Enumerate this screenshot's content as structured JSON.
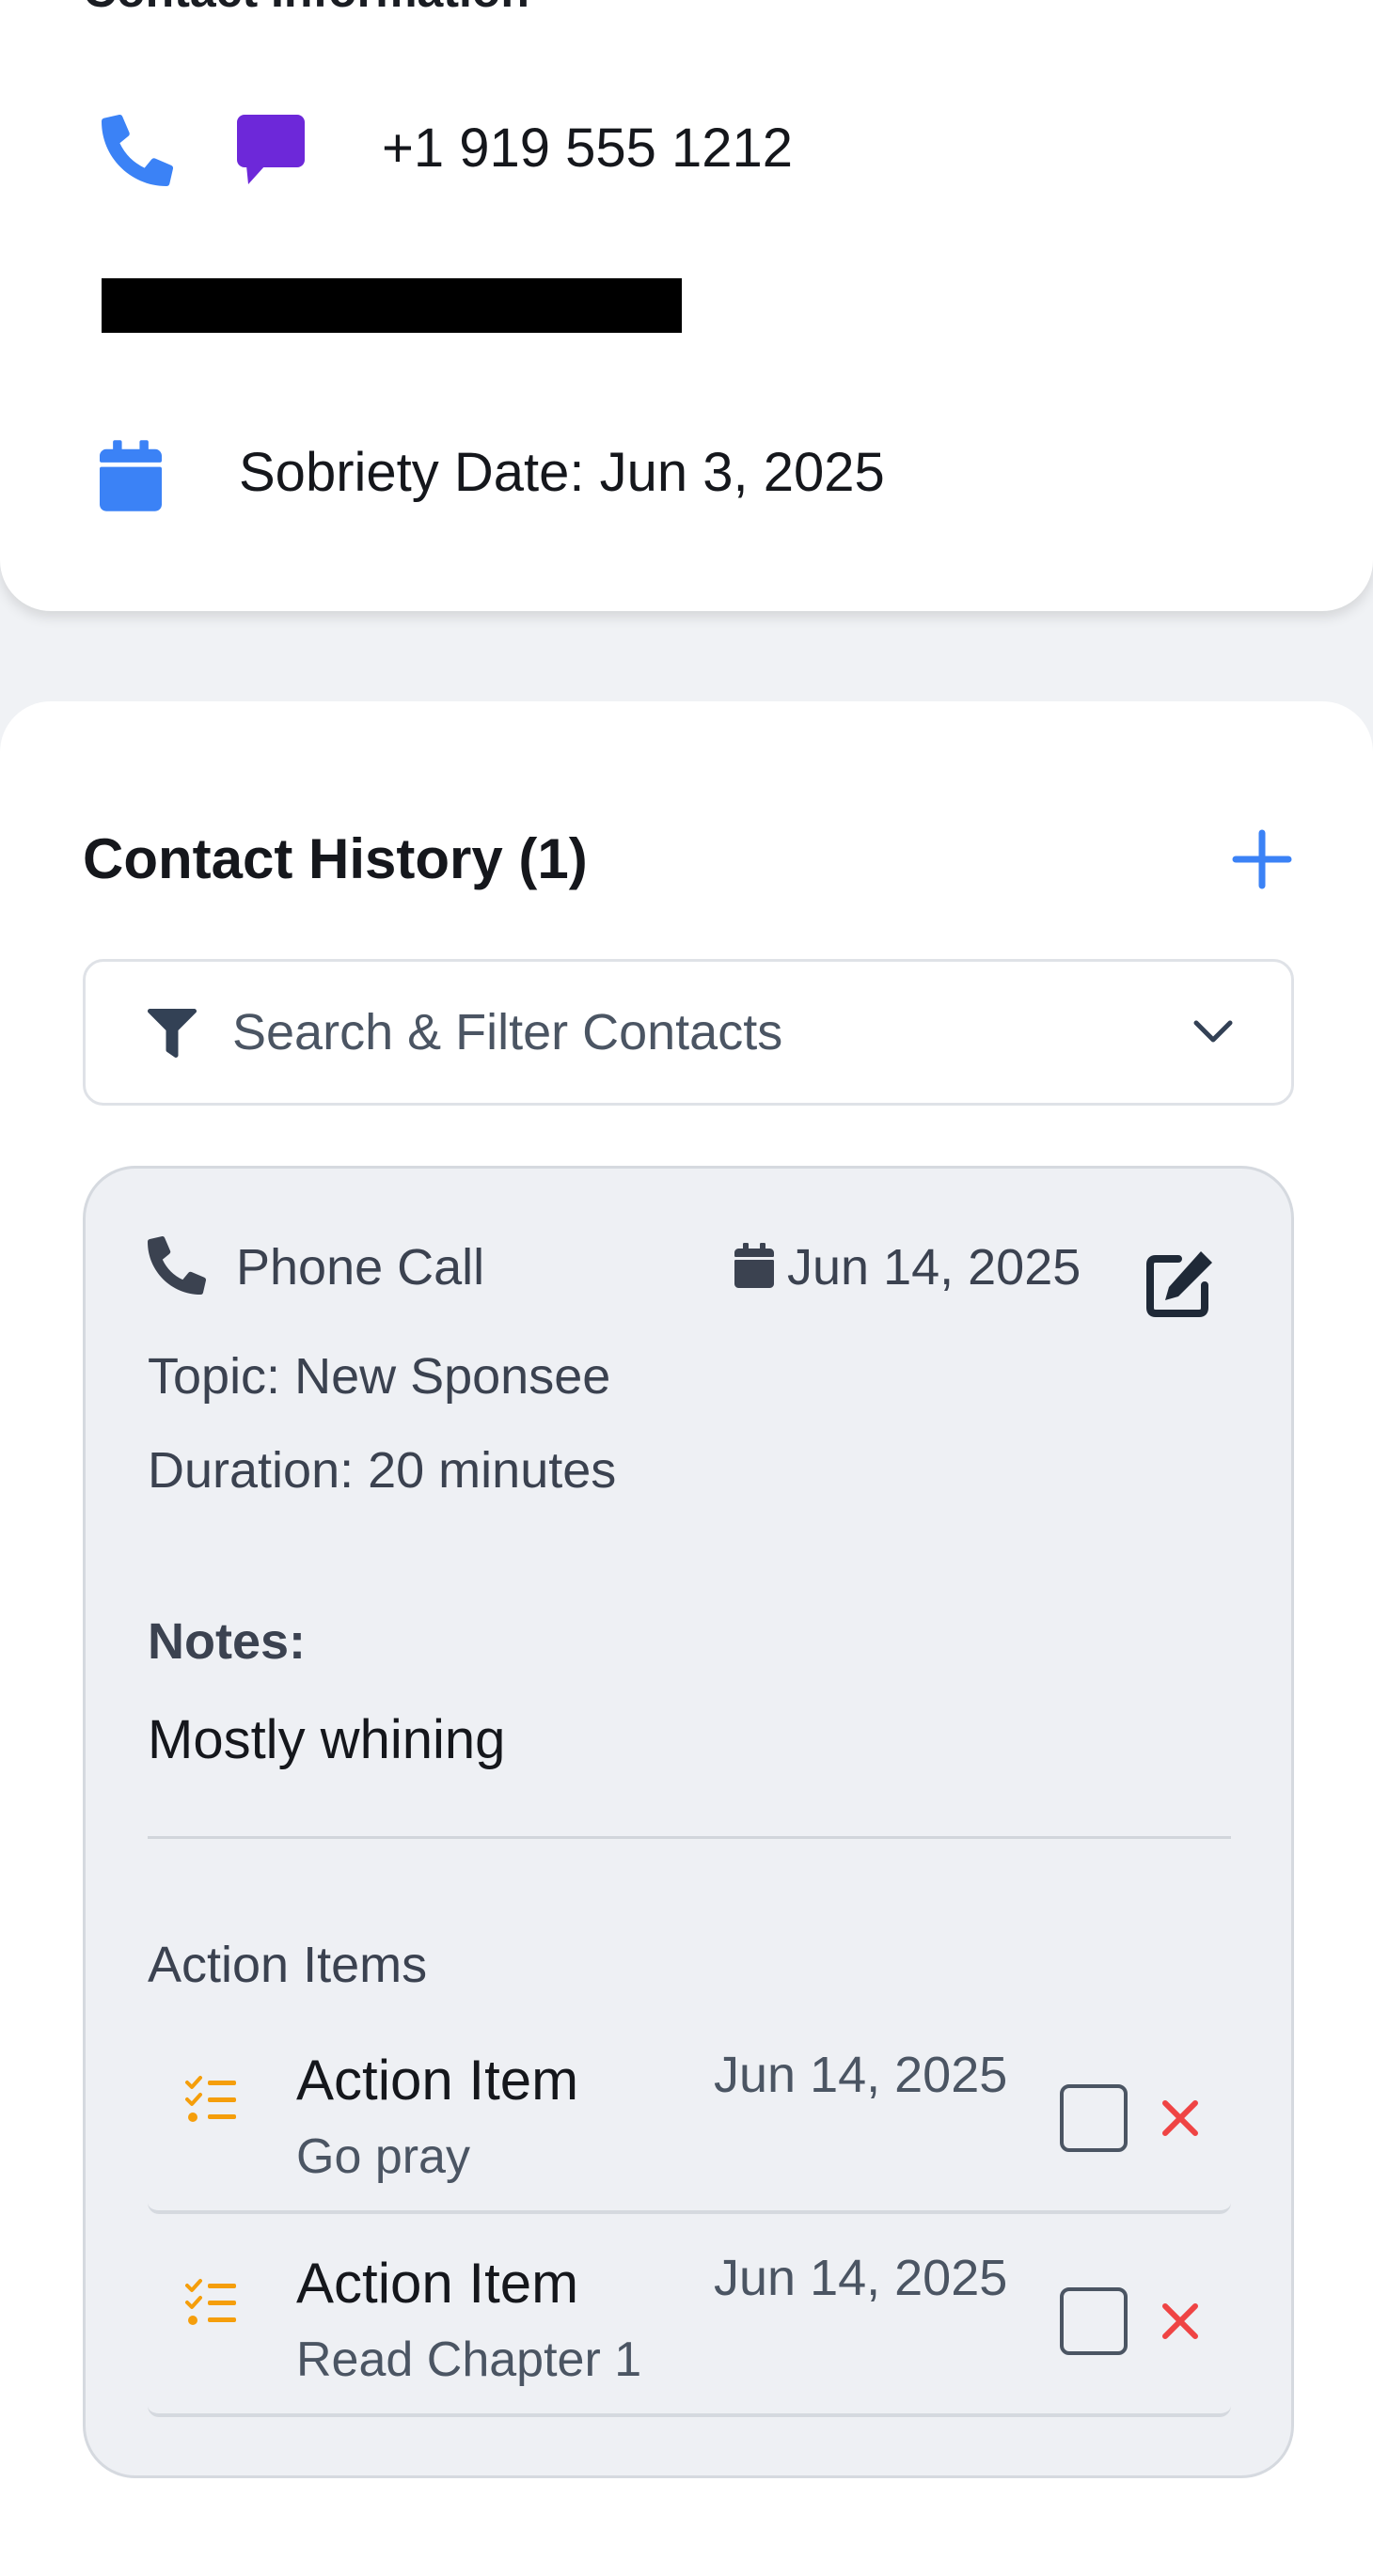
{
  "contact_info": {
    "title": "Contact Information",
    "phone": "+1 919 555 1212",
    "sobriety_label": "Sobriety Date: Jun 3, 2025"
  },
  "history": {
    "title": "Contact History (1)",
    "filter_label": "Search & Filter Contacts",
    "entries": [
      {
        "type": "Phone Call",
        "date": "Jun 14, 2025",
        "topic": "Topic: New Sponsee",
        "duration": "Duration: 20 minutes",
        "notes_label": "Notes:",
        "notes": "Mostly whining",
        "action_items_label": "Action Items",
        "action_items": [
          {
            "title": "Action Item",
            "description": "Go pray",
            "date": "Jun 14, 2025",
            "done": false
          },
          {
            "title": "Action Item",
            "description": "Read Chapter 1",
            "date": "Jun 14, 2025",
            "done": false
          }
        ]
      }
    ]
  },
  "colors": {
    "accent_blue": "#3b82f6",
    "message_purple": "#6d28d9",
    "action_orange": "#f59e0b",
    "delete_red": "#ef4444"
  },
  "icons": [
    "phone-icon",
    "message-icon",
    "calendar-icon",
    "plus-icon",
    "filter-icon",
    "chevron-down-icon",
    "edit-icon",
    "checklist-icon",
    "close-icon"
  ]
}
